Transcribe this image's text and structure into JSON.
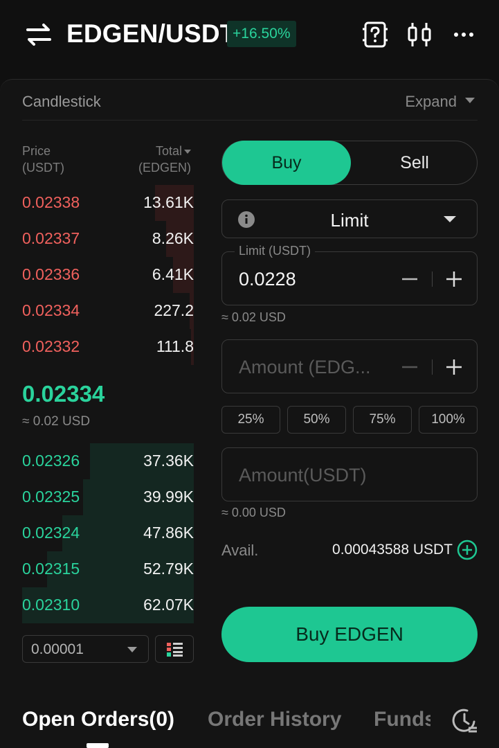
{
  "header": {
    "pair": "EDGEN/USDT",
    "change": "+16.50%",
    "icons": [
      "swap-icon",
      "help-icon",
      "candlestick-icon",
      "more-icon"
    ]
  },
  "chart_bar": {
    "label": "Candlestick",
    "expand": "Expand"
  },
  "orderbook": {
    "price_header": [
      "Price",
      "(USDT)"
    ],
    "total_header": [
      "Total",
      "(EDGEN)"
    ],
    "asks": [
      {
        "price": "0.02338",
        "total": "13.61K"
      },
      {
        "price": "0.02337",
        "total": "8.26K"
      },
      {
        "price": "0.02336",
        "total": "6.41K"
      },
      {
        "price": "0.02334",
        "total": "227.2"
      },
      {
        "price": "0.02332",
        "total": "111.8"
      }
    ],
    "mid_price": "0.02334",
    "mid_usd": "≈ 0.02 USD",
    "bids": [
      {
        "price": "0.02326",
        "total": "37.36K"
      },
      {
        "price": "0.02325",
        "total": "39.99K"
      },
      {
        "price": "0.02324",
        "total": "47.86K"
      },
      {
        "price": "0.02315",
        "total": "52.79K"
      },
      {
        "price": "0.02310",
        "total": "62.07K"
      }
    ],
    "precision": "0.00001"
  },
  "trade": {
    "buy_label": "Buy",
    "sell_label": "Sell",
    "order_type": "Limit",
    "limit_legend": "Limit (USDT)",
    "limit_value": "0.0228",
    "limit_approx": "≈ 0.02 USD",
    "amount_placeholder": "Amount (EDG...",
    "percents": [
      "25%",
      "50%",
      "75%",
      "100%"
    ],
    "amount_usdt_placeholder": "Amount(USDT)",
    "amount_usdt_approx": "≈ 0.00 USD",
    "avail_label": "Avail.",
    "avail_value": "0.00043588 USDT",
    "submit_label": "Buy EDGEN",
    "colors": {
      "buy": "#1ec792",
      "ask": "#f0615d",
      "bid": "#2ad39c"
    }
  },
  "tabs": {
    "open_orders": "Open Orders(0)",
    "order_history": "Order History",
    "funds": "Funds"
  }
}
